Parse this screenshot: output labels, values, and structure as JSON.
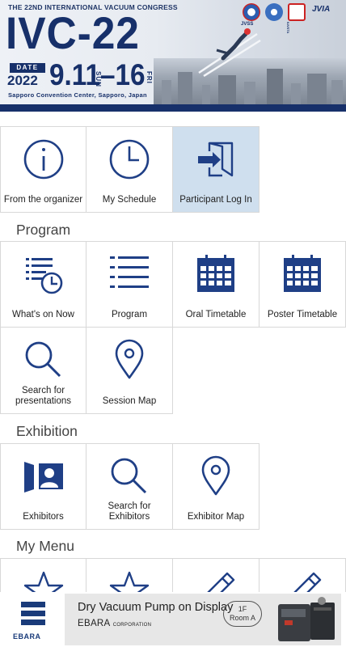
{
  "banner": {
    "congress": "THE 22ND INTERNATIONAL VACUUM CONGRESS",
    "event": "IVC-22",
    "date_label": "DATE",
    "year": "2022",
    "dates": "9.11–16",
    "day_start": "SUN",
    "day_end": "FRI",
    "venue": "Sapporo Convention Center, Sapporo, Japan",
    "logo_labels": [
      "JVSS",
      "IUVSTA",
      "JVIA"
    ]
  },
  "top_tiles": [
    {
      "label": "From the organizer",
      "icon": "info-icon"
    },
    {
      "label": "My Schedule",
      "icon": "clock-icon"
    },
    {
      "label": "Participant Log In",
      "icon": "login-icon"
    }
  ],
  "program": {
    "title": "Program",
    "tiles": [
      {
        "label": "What's on Now",
        "icon": "list-clock-icon"
      },
      {
        "label": "Program",
        "icon": "list-icon"
      },
      {
        "label": "Oral Timetable",
        "icon": "calendar-icon"
      },
      {
        "label": "Poster Timetable",
        "icon": "calendar-icon"
      },
      {
        "label": "Search for presentations",
        "icon": "search-icon"
      },
      {
        "label": "Session Map",
        "icon": "map-pin-icon"
      }
    ]
  },
  "exhibition": {
    "title": "Exhibition",
    "tiles": [
      {
        "label": "Exhibitors",
        "icon": "exhibitor-booth-icon"
      },
      {
        "label": "Search for Exhibitors",
        "icon": "search-icon"
      },
      {
        "label": "Exhibitor Map",
        "icon": "map-pin-icon"
      }
    ]
  },
  "my_menu": {
    "title": "My Menu",
    "tiles": [
      {
        "icon": "star-icon"
      },
      {
        "icon": "star-icon"
      },
      {
        "icon": "pencil-icon"
      },
      {
        "icon": "pencil-icon"
      }
    ]
  },
  "ad": {
    "brand": "EBARA",
    "title": "Dry Vacuum Pump on Display",
    "corp": "EBARA",
    "corp_suffix": "CORPORATION",
    "floor": "1F",
    "room": "Room A"
  },
  "colors": {
    "accent": "#17306a",
    "icon": "#1f3f86",
    "active_tile": "#cfdfee"
  }
}
